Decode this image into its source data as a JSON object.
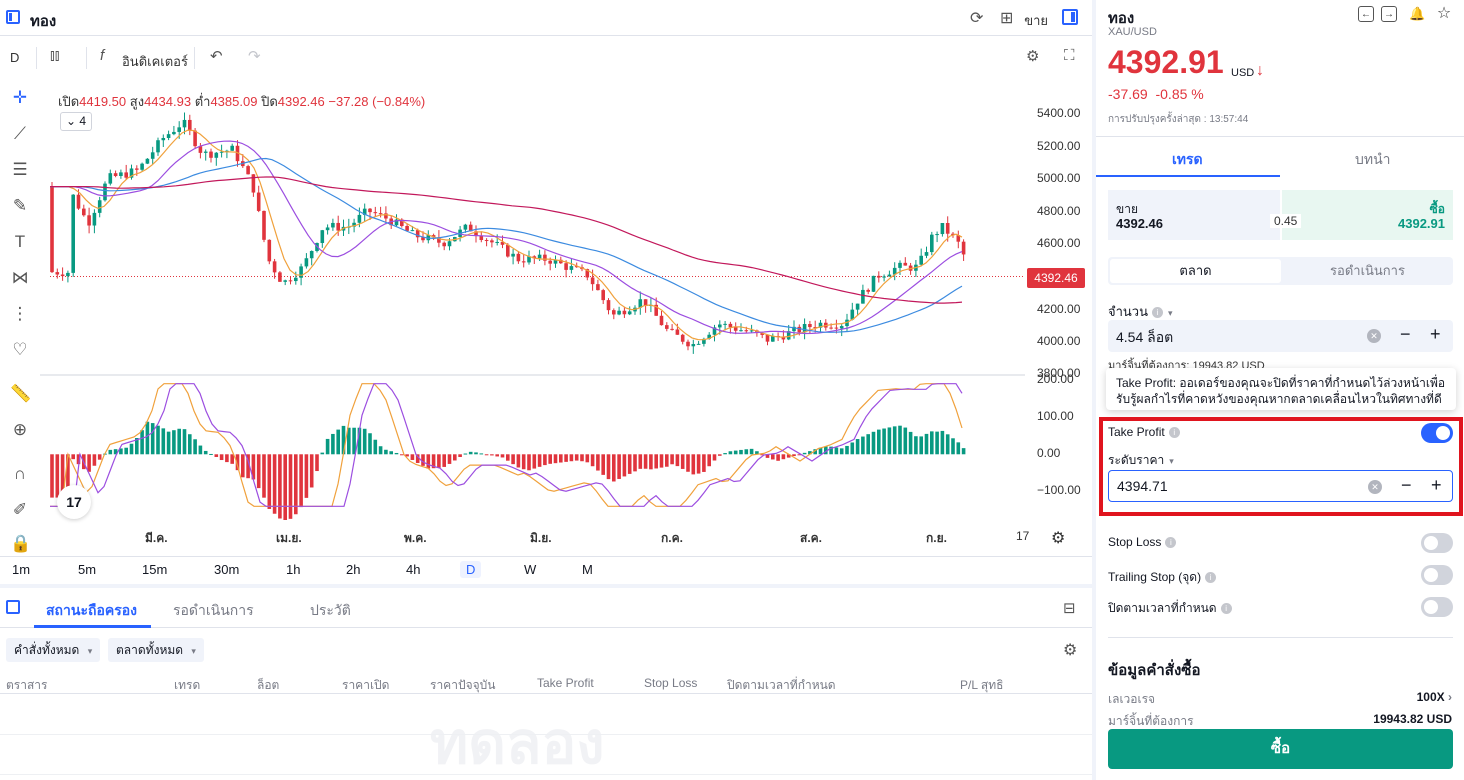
{
  "header": {
    "symbol_title": "ทอง",
    "sell_label": "ขาย"
  },
  "chart_toolbar": {
    "timeframe": "D",
    "indicators_label": "อินดิเคเตอร์"
  },
  "ohlc": {
    "open_label": "เปิด",
    "open": "4419.50",
    "high_label": "สูง",
    "high": "4434.93",
    "low_label": "ต่ำ",
    "low": "4385.09",
    "close_label": "ปิด",
    "close": "4392.46",
    "change": "−37.28 (−0.84%)",
    "indicator_count": "4"
  },
  "price_axis": {
    "labels": [
      "5400.00",
      "5200.00",
      "5000.00",
      "4800.00",
      "4600.00",
      "4400.00",
      "4200.00",
      "4000.00",
      "3800.00"
    ],
    "last_price": "4392.46"
  },
  "osc_axis": {
    "labels": [
      "200.00",
      "100.00",
      "0.00",
      "−100.00"
    ]
  },
  "date_axis": {
    "labels": [
      "มี.ค.",
      "เม.ย.",
      "พ.ค.",
      "มิ.ย.",
      "ก.ค.",
      "ส.ค.",
      "ก.ย.",
      "17"
    ]
  },
  "timeframes": [
    "1m",
    "5m",
    "15m",
    "30m",
    "1h",
    "2h",
    "4h",
    "D",
    "W",
    "M"
  ],
  "active_timeframe": "D",
  "bottom_panel": {
    "tabs": [
      "สถานะถือครอง",
      "รอดำเนินการ",
      "ประวัติ"
    ],
    "filters": [
      "คำสั่งทั้งหมด",
      "ตลาดทั้งหมด"
    ],
    "columns": [
      "ตราสาร",
      "เทรด",
      "ล็อต",
      "ราคาเปิด",
      "ราคาปัจจุบัน",
      "Take Profit",
      "Stop Loss",
      "ปิดตามเวลาที่กำหนด",
      "P/L สุทธิ"
    ],
    "watermark": "ทดลอง"
  },
  "instrument": {
    "name": "ทอง",
    "symbol": "XAU/USD",
    "price": "4392.91",
    "currency": "USD",
    "change": "-37.69",
    "change_pct": "-0.85 %",
    "last_update": "การปรับปรุงครั้งล่าสุด : 13:57:44"
  },
  "trade_tabs": [
    "เทรด",
    "บทนำ"
  ],
  "quote": {
    "sell_label": "ขาย",
    "sell_price": "4392.46",
    "buy_label": "ซื้อ",
    "buy_price": "4392.91",
    "spread": "0.45"
  },
  "order_types": [
    "ตลาด",
    "รอดำเนินการ"
  ],
  "volume": {
    "label": "จำนวน",
    "value": "4.54  ล็อต",
    "margin_note": "มาร์จิ้นที่ต้องการ: 19943.82 USD"
  },
  "tooltip": "Take Profit: ออเดอร์ของคุณจะปิดที่ราคาที่กำหนดไว้ล่วงหน้าเพื่อรับรู้ผลกำไรที่คาดหวังของคุณหากตลาดเคลื่อนไหวในทิศทางที่ดี",
  "take_profit": {
    "label": "Take Profit",
    "enabled": true,
    "price_level_label": "ระดับราคา",
    "price_value": "4394.71"
  },
  "stop_loss": {
    "label": "Stop Loss",
    "enabled": false
  },
  "trailing_stop": {
    "label": "Trailing Stop (จุด)",
    "enabled": false
  },
  "close_by_time": {
    "label": "ปิดตามเวลาที่กำหนด",
    "enabled": false
  },
  "order_info": {
    "title": "ข้อมูลคำสั่งซื้อ",
    "leverage_label": "เลเวอเรจ",
    "leverage_value": "100X",
    "margin_label": "มาร์จิ้นที่ต้องการ",
    "margin_value": "19943.82 USD"
  },
  "buy_button": "ซื้อ",
  "colors": {
    "up": "#089981",
    "down": "#e0343d",
    "accent": "#2962ff",
    "highlight_box": "#e0141e"
  },
  "chart_data": {
    "type": "candlestick",
    "price_range": [
      3800,
      5400
    ],
    "series_note": "",
    "ma_lines": [
      "orange",
      "purple",
      "blue",
      "crimson"
    ],
    "last_price": 4392.46,
    "oscillator": {
      "type": "macd",
      "range": [
        -150,
        200
      ]
    }
  }
}
